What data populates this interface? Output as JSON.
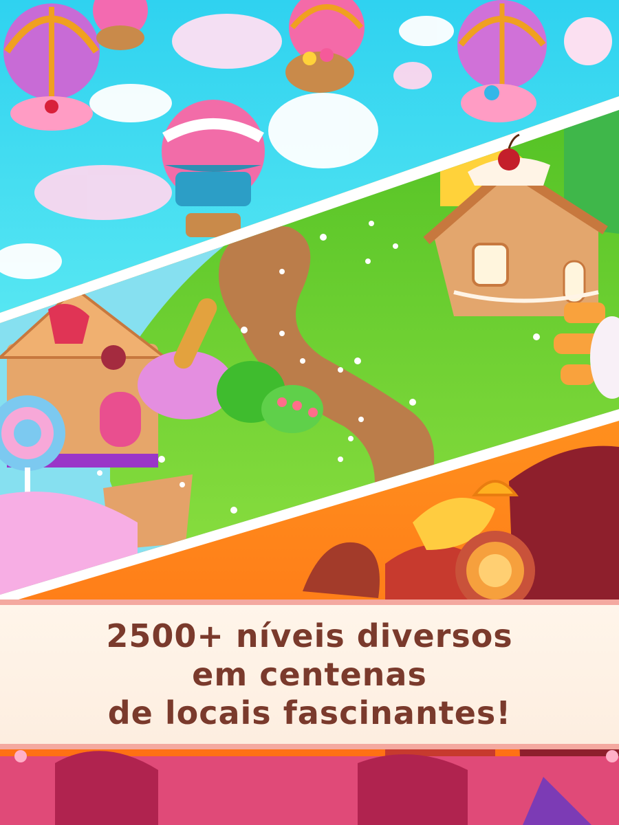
{
  "banner": {
    "line1": "2500+ níveis diversos",
    "line2": "em centenas",
    "line3": "de locais fascinantes!"
  },
  "colors": {
    "sky": "#35d6ee",
    "grass": "#6fd038",
    "path": "#b97b4a",
    "lava": "#ff9a1e",
    "banner_text": "#7a3a2c",
    "banner_border": "#f4a9a0"
  },
  "scenes": [
    "candy-sky-with-balloons",
    "gingerbread-meadow-with-path",
    "caramel-lava-land"
  ]
}
